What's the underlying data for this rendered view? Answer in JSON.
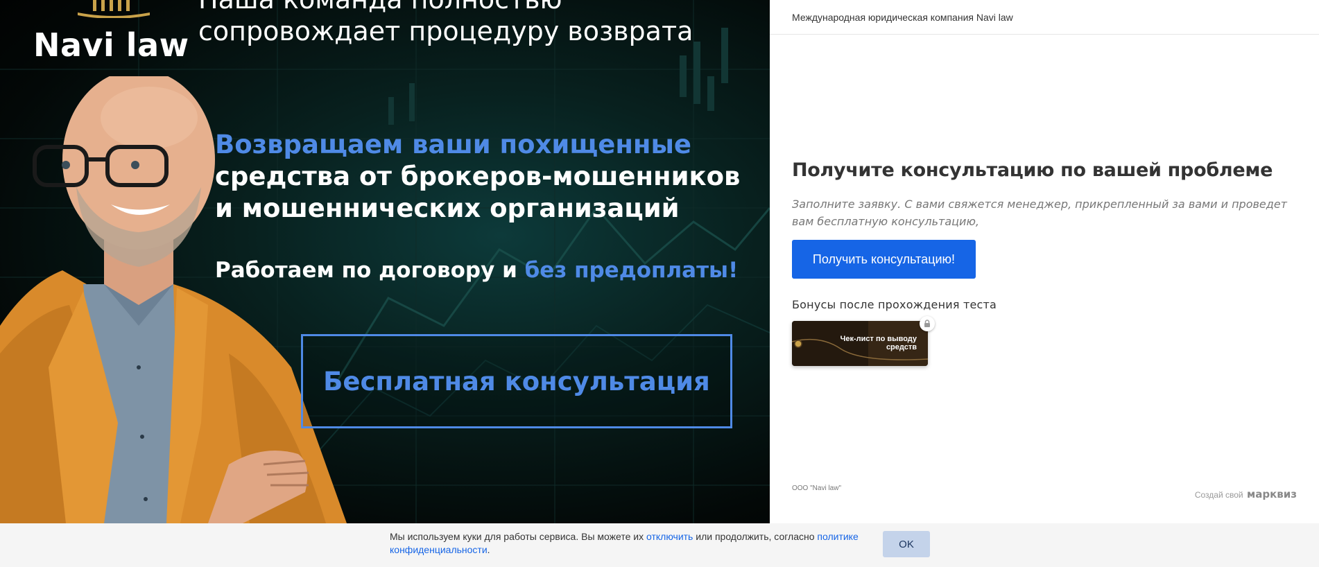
{
  "banner": {
    "logo_text": "Navi law",
    "headline_top_line1": "Наша команда полностью",
    "headline_top_line2": "сопровождает процедуру возврата",
    "title_blue": "Возвращаем ваши похищенные",
    "title_line2": "средства от брокеров-мошенников",
    "title_line3": "и мошеннических организаций",
    "subline_white": "Работаем по договору и ",
    "subline_blue": "без предоплаты!",
    "free_button": "Бесплатная консультация"
  },
  "panel": {
    "header": "Международная юридическая компания Navi law",
    "title": "Получите консультацию по вашей проблеме",
    "description": "Заполните заявку. С вами свяжется менеджер, прикрепленный за вами и проведет вам бесплатную консультацию,",
    "cta_label": "Получить консультацию!",
    "bonus_label": "Бонусы после прохождения теста",
    "bonus_card_text": "Чек-лист по выводу средств",
    "company": "ООО \"Navi law\"",
    "made_by_prefix": "Создай свой",
    "made_by_brand": "марквиз"
  },
  "cookie": {
    "text_1": "Мы используем куки для работы сервиса. Вы можете их ",
    "link_disable": "отключить",
    "text_2": " или продолжить, согласно ",
    "link_policy": "политике конфиденциальности",
    "text_3": ".",
    "ok_label": "OK"
  },
  "colors": {
    "accent_blue": "#4f8ae6",
    "cta_blue": "#1665e6",
    "gold": "#c9a24a"
  }
}
